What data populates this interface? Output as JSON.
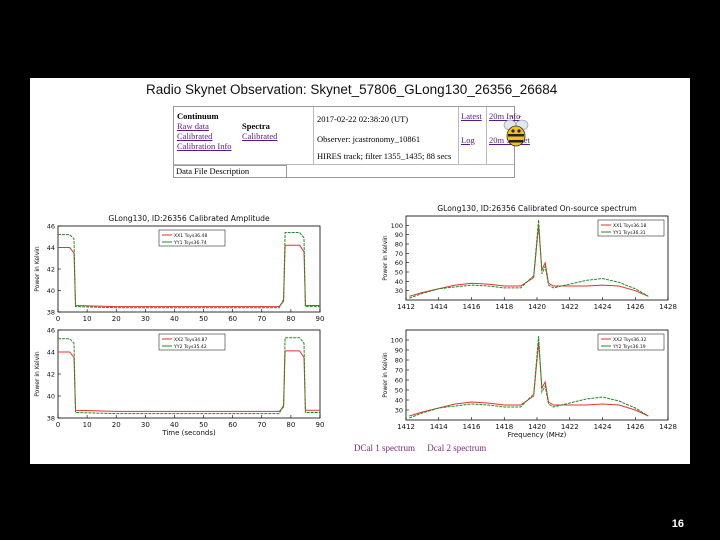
{
  "title": "Radio Skynet Observation: Skynet_57806_GLong130_26356_26684",
  "info": {
    "continuum": "Continuum",
    "raw_data": "Raw data",
    "calibrated": "Calibrated",
    "calibration_info": "Calibration Info",
    "spectra": "Spectra",
    "spectra_calibrated": "Calibrated",
    "datetime": "2017-02-22 02:38:20 (UT)",
    "observer": "Observer: jcastronomy_10861",
    "track": "HIRES track; filter 1355_1435; 88 secs",
    "latest": "Latest",
    "twenty_m_info": "20m Info",
    "log": "Log",
    "twenty_m_skynet": "20m Skynet",
    "data_file_description": "Data File Description"
  },
  "links": {
    "dcal1": "DCal 1 spectrum",
    "dcal2": "Dcal 2 spectrum"
  },
  "page_number": "16",
  "colors": {
    "red": "#e8322a",
    "green": "#228b22",
    "link": "#551a8b"
  },
  "chart_data": [
    {
      "type": "line",
      "title": "GLong130, ID:26356 Calibrated Amplitude",
      "xlabel": "",
      "ylabel": "Power in Kelvin",
      "xlim": [
        0,
        90
      ],
      "ylim": [
        38,
        46
      ],
      "xticks": [
        0,
        10,
        20,
        30,
        40,
        50,
        60,
        70,
        80,
        90
      ],
      "yticks": [
        38,
        40,
        42,
        44,
        46
      ],
      "legend": "top-center",
      "series": [
        {
          "name": "XX1 Tsys36.48",
          "color": "#e8322a",
          "x": [
            0,
            4,
            5.5,
            6,
            20,
            40,
            60,
            76,
            77.5,
            78,
            83,
            84.5,
            85,
            90
          ],
          "y": [
            44.0,
            44.0,
            43.5,
            38.6,
            38.5,
            38.5,
            38.5,
            38.5,
            39.0,
            44.2,
            44.2,
            43.6,
            38.6,
            38.6
          ]
        },
        {
          "name": "YY1 Tsys36.74",
          "color": "#228b22",
          "x": [
            0,
            4,
            5.5,
            6,
            20,
            40,
            60,
            76,
            77.5,
            78,
            83,
            84.5,
            85,
            90
          ],
          "y": [
            45.2,
            45.2,
            44.8,
            38.5,
            38.4,
            38.4,
            38.4,
            38.4,
            39.2,
            45.4,
            45.4,
            44.9,
            38.5,
            38.5
          ]
        }
      ]
    },
    {
      "type": "line",
      "title": "",
      "xlabel": "Time (seconds)",
      "ylabel": "Power in Kelvin",
      "xlim": [
        0,
        90
      ],
      "ylim": [
        38,
        46
      ],
      "xticks": [
        0,
        10,
        20,
        30,
        40,
        50,
        60,
        70,
        80,
        90
      ],
      "yticks": [
        38,
        40,
        42,
        44,
        46
      ],
      "legend": "top-center",
      "series": [
        {
          "name": "XX2 Tsys34.87",
          "color": "#e8322a",
          "x": [
            0,
            4,
            5.5,
            6,
            20,
            40,
            60,
            76,
            77.5,
            78,
            83,
            84.5,
            85,
            90
          ],
          "y": [
            44.0,
            44.0,
            43.5,
            38.7,
            38.6,
            38.6,
            38.6,
            38.6,
            39.0,
            44.1,
            44.1,
            43.5,
            38.7,
            38.7
          ]
        },
        {
          "name": "YY2 Tsys35.42",
          "color": "#228b22",
          "x": [
            0,
            4,
            5.5,
            6,
            20,
            40,
            60,
            76,
            77.5,
            78,
            83,
            84.5,
            85,
            90
          ],
          "y": [
            45.2,
            45.2,
            44.8,
            38.5,
            38.4,
            38.4,
            38.4,
            38.4,
            39.2,
            45.3,
            45.3,
            44.8,
            38.5,
            38.5
          ]
        }
      ]
    },
    {
      "type": "line",
      "title": "GLong130, ID:26356 Calibrated On-source spectrum",
      "xlabel": "",
      "ylabel": "Power in Kelvin",
      "xlim": [
        1412,
        1428
      ],
      "ylim": [
        20,
        110
      ],
      "xticks": [
        1412,
        1414,
        1416,
        1418,
        1420,
        1422,
        1424,
        1426,
        1428
      ],
      "yticks": [
        30,
        40,
        50,
        60,
        70,
        80,
        90,
        100
      ],
      "legend": "top-right",
      "series": [
        {
          "name": "XX1 Tsys36.18",
          "color": "#e8322a",
          "x": [
            1412.2,
            1413,
            1414,
            1415,
            1416,
            1417,
            1418,
            1419,
            1419.8,
            1420.1,
            1420.3,
            1420.5,
            1420.7,
            1421,
            1422,
            1423,
            1424,
            1425,
            1426,
            1426.8
          ],
          "y": [
            24,
            28,
            32,
            36,
            38,
            37,
            35,
            35,
            44,
            100,
            52,
            60,
            38,
            35,
            35,
            35,
            36,
            35,
            30,
            24
          ]
        },
        {
          "name": "YY1 Tsys36.31",
          "color": "#228b22",
          "x": [
            1412.2,
            1413,
            1414,
            1415,
            1416,
            1417,
            1418,
            1419,
            1419.8,
            1420.1,
            1420.3,
            1420.5,
            1420.7,
            1421,
            1422,
            1423,
            1424,
            1425,
            1426,
            1426.8
          ],
          "y": [
            22,
            27,
            32,
            34,
            36,
            35,
            33,
            33,
            46,
            106,
            48,
            56,
            36,
            33,
            37,
            41,
            43,
            39,
            32,
            24
          ]
        }
      ]
    },
    {
      "type": "line",
      "title": "",
      "xlabel": "Frequency (MHz)",
      "ylabel": "Power in Kelvin",
      "xlim": [
        1412,
        1428
      ],
      "ylim": [
        20,
        110
      ],
      "xticks": [
        1412,
        1414,
        1416,
        1418,
        1420,
        1422,
        1424,
        1426,
        1428
      ],
      "yticks": [
        30,
        40,
        50,
        60,
        70,
        80,
        90,
        100
      ],
      "legend": "top-right",
      "series": [
        {
          "name": "XX2 Tsys36.32",
          "color": "#e8322a",
          "x": [
            1412.2,
            1413,
            1414,
            1415,
            1416,
            1417,
            1418,
            1419,
            1419.8,
            1420.1,
            1420.3,
            1420.5,
            1420.7,
            1421,
            1422,
            1423,
            1424,
            1425,
            1426,
            1426.8
          ],
          "y": [
            24,
            28,
            32,
            36,
            38,
            37,
            35,
            35,
            44,
            98,
            52,
            58,
            38,
            35,
            35,
            35,
            36,
            35,
            30,
            24
          ]
        },
        {
          "name": "YY2 Tsys36.19",
          "color": "#228b22",
          "x": [
            1412.2,
            1413,
            1414,
            1415,
            1416,
            1417,
            1418,
            1419,
            1419.8,
            1420.1,
            1420.3,
            1420.5,
            1420.7,
            1421,
            1422,
            1423,
            1424,
            1425,
            1426,
            1426.8
          ],
          "y": [
            22,
            27,
            32,
            34,
            36,
            35,
            33,
            33,
            46,
            104,
            48,
            54,
            36,
            33,
            37,
            41,
            43,
            39,
            32,
            24
          ]
        }
      ]
    }
  ]
}
